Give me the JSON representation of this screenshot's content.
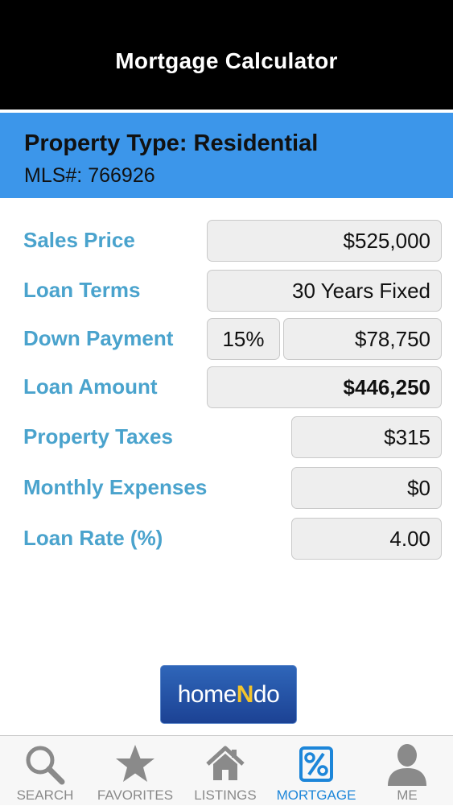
{
  "header": {
    "title": "Mortgage Calculator"
  },
  "property": {
    "type": "Property Type: Residential",
    "mls": "MLS#: 766926"
  },
  "form": {
    "sales_price": {
      "label": "Sales Price",
      "value": "$525,000"
    },
    "loan_terms": {
      "label": "Loan Terms",
      "value": "30 Years Fixed"
    },
    "down_payment": {
      "label": "Down Payment",
      "percent": "15%",
      "value": "$78,750"
    },
    "loan_amount": {
      "label": "Loan Amount",
      "value": "$446,250"
    },
    "property_taxes": {
      "label": "Property Taxes",
      "value": "$315"
    },
    "monthly_expenses": {
      "label": "Monthly Expenses",
      "value": "$0"
    },
    "loan_rate": {
      "label": "Loan Rate (%)",
      "value": "4.00"
    }
  },
  "logo": {
    "text_before": "home",
    "text_accent": "N",
    "text_after": "do"
  },
  "tabs": [
    {
      "label": "SEARCH",
      "icon": "search-icon"
    },
    {
      "label": "FAVORITES",
      "icon": "star-icon"
    },
    {
      "label": "LISTINGS",
      "icon": "house-icon"
    },
    {
      "label": "MORTGAGE",
      "icon": "percent-icon",
      "active": true
    },
    {
      "label": "ME",
      "icon": "person-icon"
    }
  ],
  "colors": {
    "accent": "#3c96ea",
    "label": "#4aa3cd",
    "active_tab": "#1d86d9",
    "header": "#000000"
  }
}
